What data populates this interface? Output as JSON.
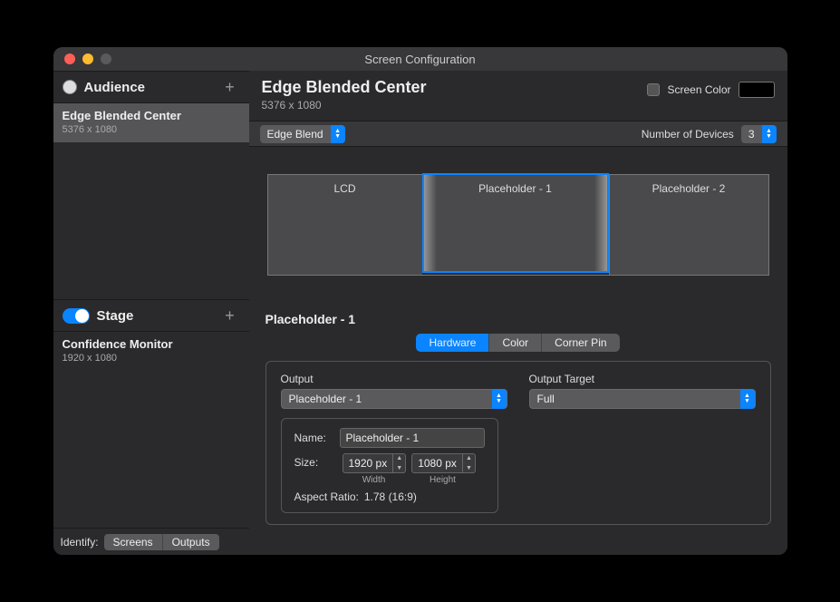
{
  "window_title": "Screen Configuration",
  "sidebar": {
    "audience": {
      "label": "Audience",
      "items": [
        {
          "name": "Edge Blended Center",
          "resolution": "5376 x 1080"
        }
      ]
    },
    "stage": {
      "label": "Stage",
      "items": [
        {
          "name": "Confidence Monitor",
          "resolution": "1920 x 1080"
        }
      ]
    },
    "identify": {
      "label": "Identify:",
      "screens": "Screens",
      "outputs": "Outputs"
    }
  },
  "main": {
    "title": "Edge Blended Center",
    "resolution": "5376 x 1080",
    "screen_color_label": "Screen Color",
    "mode_dropdown": "Edge Blend",
    "num_devices_label": "Number of Devices",
    "num_devices_value": "3",
    "devices": [
      "LCD",
      "Placeholder - 1",
      "Placeholder - 2"
    ]
  },
  "detail": {
    "title": "Placeholder - 1",
    "tabs": {
      "hardware": "Hardware",
      "color": "Color",
      "corner_pin": "Corner Pin"
    },
    "output_label": "Output",
    "output_value": "Placeholder - 1",
    "output_target_label": "Output Target",
    "output_target_value": "Full",
    "name_label": "Name:",
    "name_value": "Placeholder - 1",
    "size_label": "Size:",
    "width_value": "1920 px",
    "height_value": "1080 px",
    "width_caption": "Width",
    "height_caption": "Height",
    "aspect_label": "Aspect Ratio:",
    "aspect_value": "1.78 (16:9)"
  }
}
